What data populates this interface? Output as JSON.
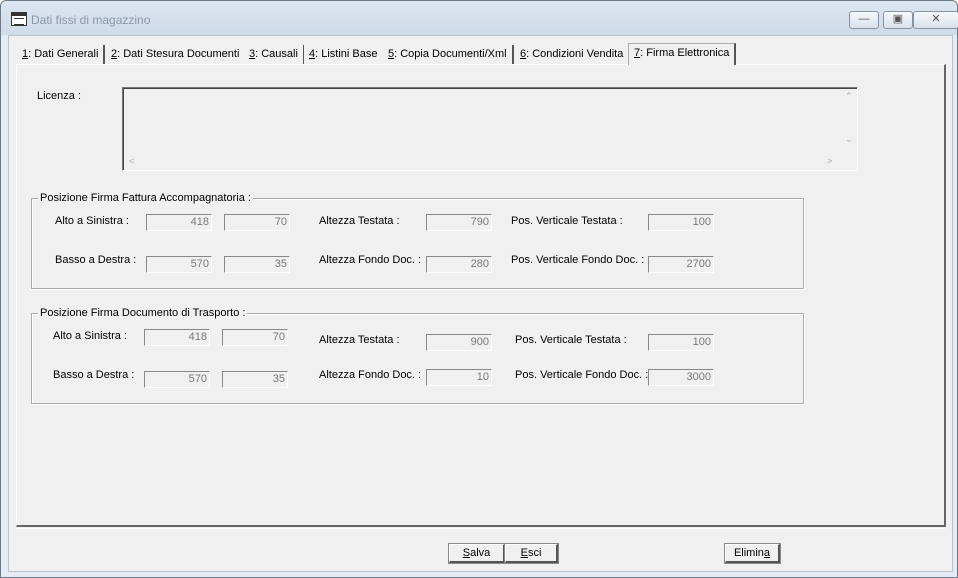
{
  "window": {
    "title": "Dati fissi di magazzino"
  },
  "tabs": [
    {
      "key": "1",
      "label": ": Dati Generali"
    },
    {
      "key": "2",
      "label": ": Dati Stesura Documenti"
    },
    {
      "key": "3",
      "label": ": Causali"
    },
    {
      "key": "4",
      "label": ": Listini Base"
    },
    {
      "key": "5",
      "label": ": Copia Documenti/Xml"
    },
    {
      "key": "6",
      "label": ": Condizioni Vendita"
    },
    {
      "key": "7",
      "label": ": Firma Elettronica"
    }
  ],
  "licenza": {
    "label": "Licenza :",
    "value": ""
  },
  "fattura": {
    "title": "Posizione Firma Fattura Accompagnatoria :",
    "alto_label": "Alto a Sinistra :",
    "alto_x": "418",
    "alto_y": "70",
    "basso_label": "Basso a Destra :",
    "basso_x": "570",
    "basso_y": "35",
    "alt_testata_label": "Altezza Testata :",
    "alt_testata": "790",
    "alt_fondo_label": "Altezza Fondo Doc. :",
    "alt_fondo": "280",
    "pos_testata_label": "Pos. Verticale Testata :",
    "pos_testata": "100",
    "pos_fondo_label": "Pos. Verticale Fondo Doc. :",
    "pos_fondo": "2700"
  },
  "trasporto": {
    "title": "Posizione Firma Documento di Trasporto :",
    "alto_label": "Alto a Sinistra :",
    "alto_x": "418",
    "alto_y": "70",
    "basso_label": "Basso a Destra :",
    "basso_x": "570",
    "basso_y": "35",
    "alt_testata_label": "Altezza Testata :",
    "alt_testata": "900",
    "alt_fondo_label": "Altezza Fondo Doc. :",
    "alt_fondo": "10",
    "pos_testata_label": "Pos. Verticale Testata :",
    "pos_testata": "100",
    "pos_fondo_label": "Pos. Verticale Fondo Doc. :",
    "pos_fondo": "3000"
  },
  "buttons": {
    "salva_key": "S",
    "salva_rest": "alva",
    "esci_key": "E",
    "esci_rest": "sci",
    "elimina_pre": "Elimin",
    "elimina_key": "a"
  }
}
